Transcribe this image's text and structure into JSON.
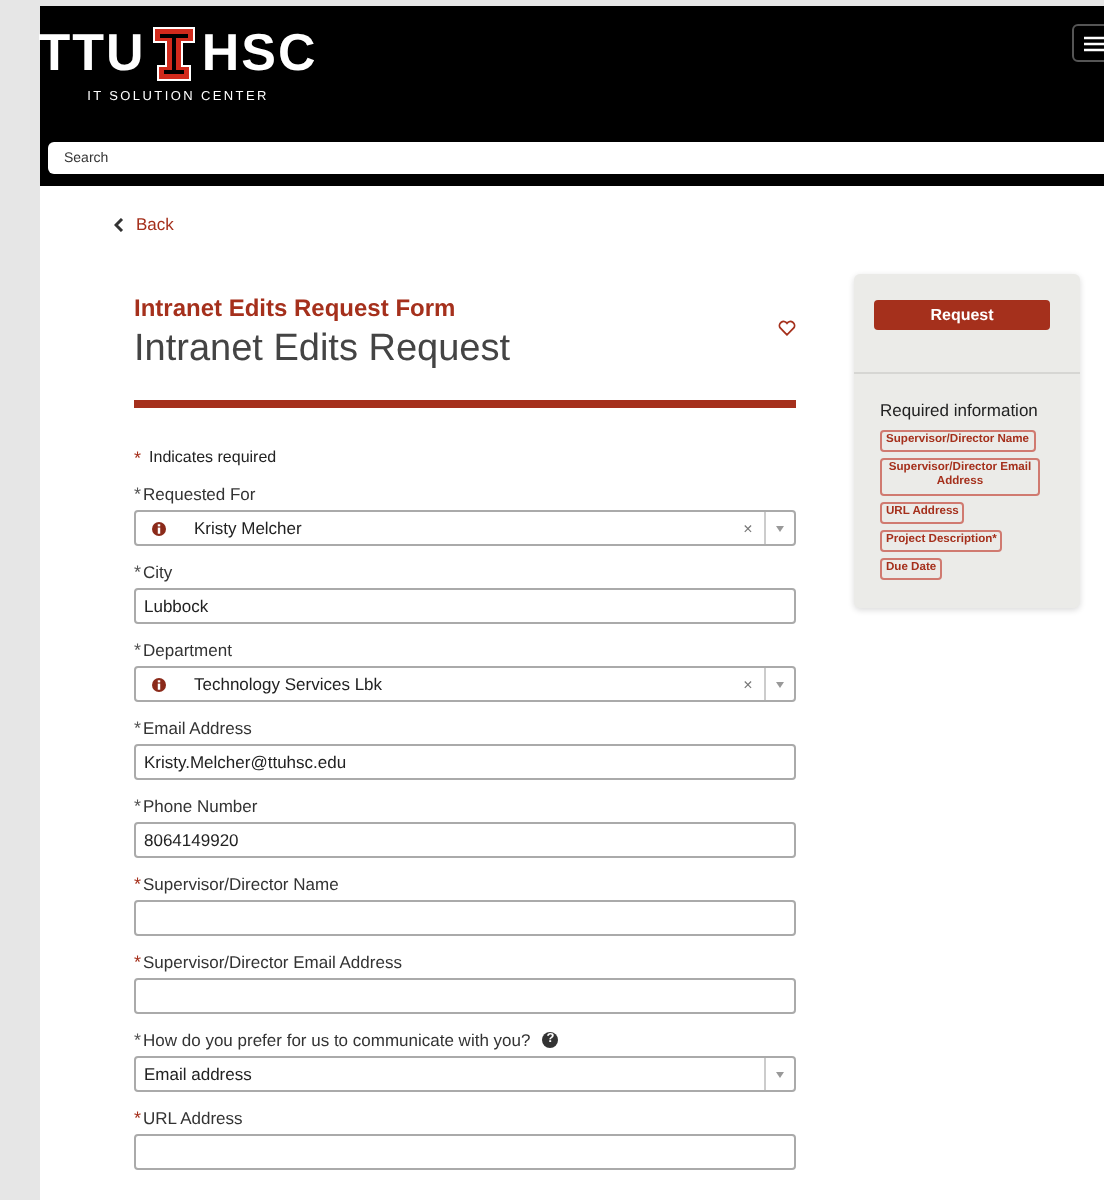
{
  "header": {
    "logo_left": "TTU",
    "logo_right": "HSC",
    "logo_subtitle": "IT SOLUTION CENTER",
    "search": {
      "placeholder": "Search"
    }
  },
  "back_link": "Back",
  "form": {
    "subtitle": "Intranet Edits Request Form",
    "title": "Intranet Edits Request",
    "favorite": false,
    "required_mark": "*",
    "required_note": "Indicates required",
    "fields": [
      {
        "required_mark": "*",
        "label": "Requested For",
        "kind": "reference",
        "value": "Kristy Melcher",
        "clear": "×",
        "satisfied": true
      },
      {
        "required_mark": "*",
        "label": "City",
        "kind": "text",
        "value": "Lubbock",
        "satisfied": true
      },
      {
        "required_mark": "*",
        "label": "Department",
        "kind": "reference",
        "value": "Technology Services Lbk",
        "clear": "×",
        "satisfied": true
      },
      {
        "required_mark": "*",
        "label": "Email Address",
        "kind": "text",
        "value": "Kristy.Melcher@ttuhsc.edu",
        "satisfied": true
      },
      {
        "required_mark": "*",
        "label": "Phone Number",
        "kind": "text",
        "value": "8064149920",
        "satisfied": true
      },
      {
        "required_mark": "*",
        "label": "Supervisor/Director Name",
        "kind": "text",
        "satisfied": false
      },
      {
        "required_mark": "*",
        "label": "Supervisor/Director Email Address",
        "kind": "text",
        "satisfied": false
      },
      {
        "required_mark": "*",
        "label": "How do you prefer for us to communicate with you?",
        "kind": "choice",
        "value": "Email address",
        "satisfied": true,
        "help": "?"
      },
      {
        "required_mark": "*",
        "label": "URL Address",
        "kind": "text",
        "satisfied": false
      }
    ]
  },
  "sidebar": {
    "button": "Request",
    "heading": "Required information",
    "tags": [
      "Supervisor/Director Name",
      "Supervisor/Director Email Address",
      "URL Address",
      "Project Description*",
      "Due Date"
    ]
  }
}
